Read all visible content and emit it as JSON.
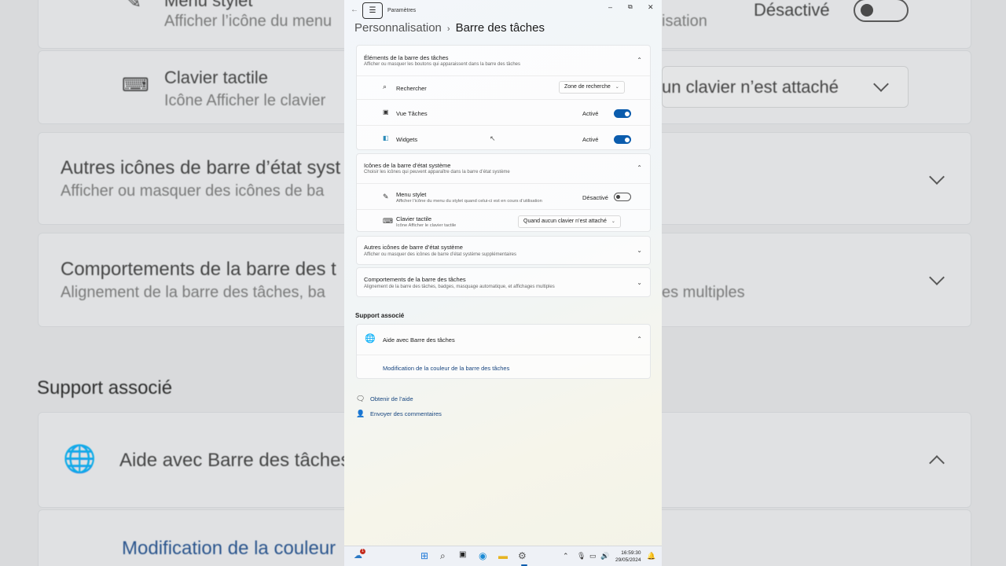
{
  "background": {
    "row_menu_stylet": {
      "title": "Menu stylet",
      "sub": "Afficher l’icône du menu",
      "right": "Désactivé"
    },
    "row_clavier": {
      "title": "Clavier tactile",
      "sub": "Icône Afficher le clavier",
      "right": "un clavier n’est attaché"
    },
    "row_autres": {
      "title": "Autres icônes de barre d’état syst",
      "sub": "Afficher ou masquer des icônes de ba"
    },
    "row_comport": {
      "title": "Comportements de la barre des t",
      "sub": "Alignement de la barre des tâches, ba",
      "right": "es multiples"
    },
    "right_fragment_1": "isation",
    "support": "Support associé",
    "aide": "Aide avec Barre des tâches",
    "modif": "Modification de la couleur"
  },
  "window": {
    "title": "Paramètres",
    "breadcrumb_parent": "Personnalisation",
    "breadcrumb_current": "Barre des tâches"
  },
  "elements": {
    "title": "Éléments de la barre des tâches",
    "sub": "Afficher ou masquer les boutons qui apparaissent dans la barre des tâches",
    "rows": [
      {
        "label": "Rechercher",
        "dropdown": "Zone de recherche"
      },
      {
        "label": "Vue Tâches",
        "state": "Activé"
      },
      {
        "label": "Widgets",
        "state": "Activé"
      }
    ]
  },
  "tray_icons": {
    "title": "Icônes de la barre d’état système",
    "sub": "Choisir les icônes qui peuvent apparaître dans la barre d’état système",
    "menu_stylet": {
      "label": "Menu stylet",
      "sub": "Afficher l’icône du menu du stylet quand celui-ci est en cours d’utilisation",
      "state": "Désactivé"
    },
    "clavier": {
      "label": "Clavier tactile",
      "sub": "Icône Afficher le clavier tactile",
      "dropdown": "Quand aucun clavier n’est attaché"
    }
  },
  "autres": {
    "title": "Autres icônes de barre d’état système",
    "sub": "Afficher ou masquer des icônes de barre d’état système supplémentaires"
  },
  "comportements": {
    "title": "Comportements de la barre des tâches",
    "sub": "Alignement de la barre des tâches, badges, masquage automatique, et affichages multiples"
  },
  "support": {
    "heading": "Support associé",
    "aide": "Aide avec Barre des tâches",
    "link": "Modification de la couleur de la barre des tâches"
  },
  "footer": {
    "help": "Obtenir de l’aide",
    "feedback": "Envoyer des commentaires"
  },
  "taskbar": {
    "time": "16:59:30",
    "date": "29/05/2024",
    "badge": "1"
  }
}
